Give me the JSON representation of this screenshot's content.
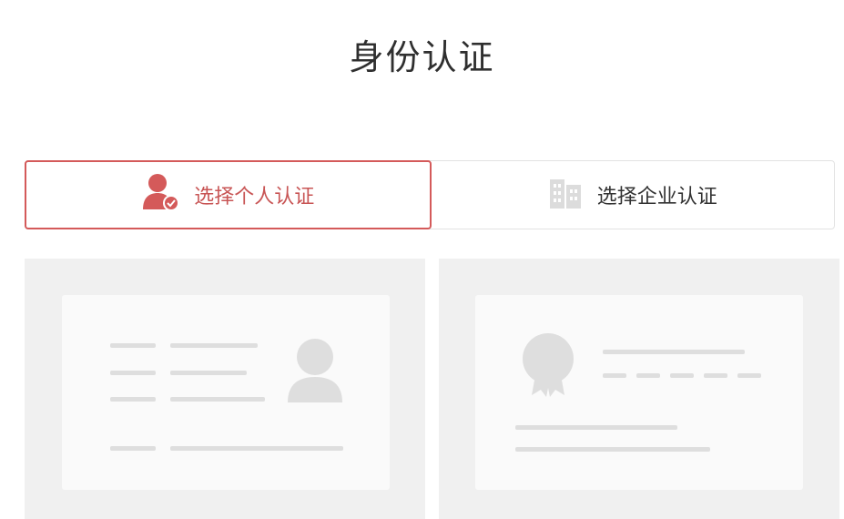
{
  "page": {
    "title": "身份认证"
  },
  "tabs": [
    {
      "label": "选择个人认证",
      "icon": "person-check-icon",
      "selected": true
    },
    {
      "label": "选择企业认证",
      "icon": "building-icon",
      "selected": false
    }
  ],
  "colors": {
    "accent": "#d45a5a",
    "placeholder": "#dedede",
    "panel_bg": "#f0f0f0"
  },
  "illustrations": {
    "personal": {
      "icon": "avatar-placeholder-icon"
    },
    "enterprise": {
      "icon": "seal-placeholder-icon"
    }
  }
}
